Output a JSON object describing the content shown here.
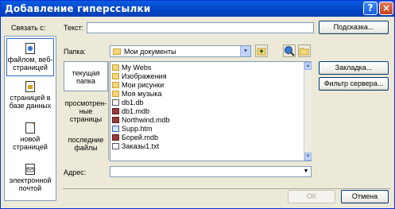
{
  "window": {
    "title": "Добавление гиперссылки",
    "help_icon": "?",
    "close_icon": "×"
  },
  "link_to": {
    "label": "Связать с:",
    "items": [
      {
        "label": "файлом, веб-страницей",
        "icon": "globe-page-icon"
      },
      {
        "label": "страницей в базе данных",
        "icon": "database-page-icon"
      },
      {
        "label": "новой страницей",
        "icon": "new-page-icon"
      },
      {
        "label": "электронной почтой",
        "icon": "email-icon"
      }
    ]
  },
  "text_field": {
    "label": "Текст:",
    "value": ""
  },
  "screen_tip_button": "Подсказка...",
  "folder": {
    "label": "Папка:",
    "value": "Мои документы"
  },
  "places": [
    {
      "label": "текущая папка"
    },
    {
      "label": "просмотрен-ные страницы"
    },
    {
      "label": "последние файлы"
    }
  ],
  "files": [
    {
      "name": "My Webs",
      "type": "folder"
    },
    {
      "name": "Изображения",
      "type": "folder"
    },
    {
      "name": "Мои рисунки",
      "type": "folder"
    },
    {
      "name": "Моя музыка",
      "type": "folder"
    },
    {
      "name": "db1.db",
      "type": "doc"
    },
    {
      "name": "db1.mdb",
      "type": "mdb"
    },
    {
      "name": "Northwind.mdb",
      "type": "mdb"
    },
    {
      "name": "Supp.htm",
      "type": "htm"
    },
    {
      "name": "Борей.mdb",
      "type": "mdb"
    },
    {
      "name": "Заказы1.txt",
      "type": "doc"
    }
  ],
  "bookmark_button": "Закладка...",
  "server_filter_button": "Фильтр сервера...",
  "address": {
    "label": "Адрес:",
    "value": ""
  },
  "ok_button": "ОК",
  "cancel_button": "Отмена"
}
